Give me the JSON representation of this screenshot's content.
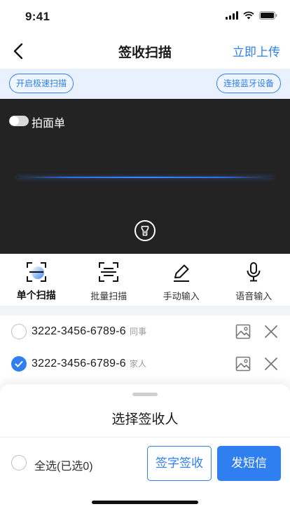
{
  "status_bar": {
    "time": "9:41"
  },
  "nav": {
    "title": "签收扫描",
    "upload_label": "立即上传"
  },
  "actions": {
    "fast_scan_label": "开启极速扫描",
    "bluetooth_label": "连接蓝牙设备"
  },
  "camera": {
    "toggle_label": "拍面单",
    "toggle_on": false
  },
  "mode_tabs": [
    {
      "label": "单个扫描",
      "icon": "scan-frame-icon",
      "active": true
    },
    {
      "label": "批量扫描",
      "icon": "batch-scan-icon",
      "active": false
    },
    {
      "label": "手动输入",
      "icon": "pen-icon",
      "active": false
    },
    {
      "label": "语音输入",
      "icon": "microphone-icon",
      "active": false
    }
  ],
  "items": [
    {
      "code": "3222-3456-6789-6",
      "tag": "同事",
      "checked": false
    },
    {
      "code": "3222-3456-6789-6",
      "tag": "家人",
      "checked": true
    }
  ],
  "sheet": {
    "title": "选择签收人",
    "select_all_label": "全选(已选0)",
    "signature_button": "签字签收",
    "sms_button": "发短信"
  },
  "colors": {
    "accent": "#2f7ff0",
    "camera_bg": "#232323",
    "strip_bg": "#e8f1fd"
  }
}
